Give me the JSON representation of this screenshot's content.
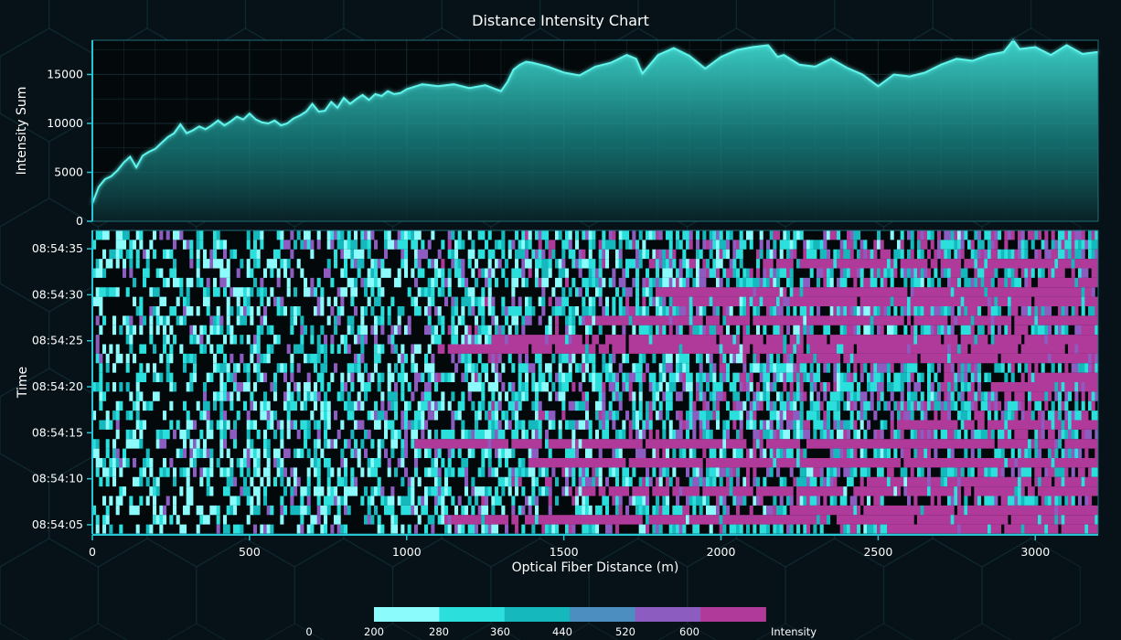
{
  "chart_data": [
    {
      "type": "area",
      "title": "Distance Intensity Chart",
      "ylabel": "Intensity Sum",
      "xlim": [
        0,
        3200
      ],
      "ylim": [
        0,
        18500
      ],
      "yticks": [
        0,
        5000,
        10000,
        15000
      ],
      "grid": true,
      "line_color": "#5ff5ec",
      "series": [
        {
          "x": [
            0,
            20,
            40,
            60,
            80,
            100,
            120,
            140,
            160,
            180,
            200,
            220,
            240,
            260,
            280,
            300,
            320,
            340,
            360,
            380,
            400,
            420,
            440,
            460,
            480,
            500,
            520,
            540,
            560,
            580,
            600,
            620,
            640,
            660,
            680,
            700,
            720,
            740,
            760,
            780,
            800,
            820,
            840,
            860,
            880,
            900,
            920,
            940,
            960,
            980,
            1000,
            1050,
            1100,
            1150,
            1200,
            1250,
            1300,
            1320,
            1340,
            1360,
            1380,
            1400,
            1450,
            1500,
            1550,
            1600,
            1650,
            1700,
            1730,
            1750,
            1800,
            1850,
            1900,
            1950,
            2000,
            2050,
            2100,
            2150,
            2180,
            2200,
            2250,
            2300,
            2350,
            2400,
            2450,
            2500,
            2550,
            2600,
            2650,
            2700,
            2750,
            2800,
            2850,
            2900,
            2930,
            2950,
            3000,
            3050,
            3100,
            3150,
            3200
          ],
          "values": [
            1800,
            3500,
            4300,
            4600,
            5200,
            6000,
            6600,
            5500,
            6700,
            7100,
            7400,
            8000,
            8600,
            9000,
            9900,
            9000,
            9300,
            9700,
            9400,
            9800,
            10300,
            9800,
            10200,
            10700,
            10400,
            11000,
            10400,
            10100,
            10000,
            10300,
            9800,
            10000,
            10500,
            10800,
            11200,
            12000,
            11200,
            11300,
            12200,
            11600,
            12600,
            12000,
            12500,
            12900,
            12400,
            13000,
            12800,
            13300,
            13000,
            13100,
            13500,
            14000,
            13800,
            14000,
            13600,
            13900,
            13300,
            14200,
            15500,
            16000,
            16300,
            16200,
            15800,
            15200,
            14900,
            15800,
            16200,
            17000,
            16600,
            15100,
            17000,
            17700,
            16900,
            15600,
            16800,
            17500,
            17800,
            18000,
            16800,
            17000,
            16000,
            15800,
            16600,
            15700,
            15000,
            13800,
            15000,
            14800,
            15200,
            16000,
            16600,
            16400,
            17000,
            17300,
            18500,
            17600,
            17800,
            17000,
            18000,
            17100,
            17300
          ]
        }
      ]
    },
    {
      "type": "heatmap",
      "xlabel": "Optical Fiber Distance (m)",
      "ylabel": "Time",
      "xlim": [
        0,
        3200
      ],
      "xticks": [
        0,
        500,
        1000,
        1500,
        2000,
        2500,
        3000
      ],
      "time_ticks": [
        "08:54:05",
        "08:54:10",
        "08:54:15",
        "08:54:20",
        "08:54:25",
        "08:54:30",
        "08:54:35"
      ],
      "time_range": [
        "08:54:04",
        "08:54:37"
      ],
      "rows": 32,
      "columns": 300,
      "colorbar": {
        "label": "Intensity",
        "ticks": [
          0,
          200,
          280,
          360,
          440,
          520,
          600
        ],
        "colors": [
          "#000000",
          "#8bfbfc",
          "#2be0dc",
          "#15b8bc",
          "#4c8ec0",
          "#8d5cc0",
          "#b03a9a"
        ],
        "position": "bottom"
      },
      "note_values": "Dense intensity matrix: low (black) near 0 m, rising with distance; magenta bands (~600+) increasing toward 3200 m."
    }
  ]
}
